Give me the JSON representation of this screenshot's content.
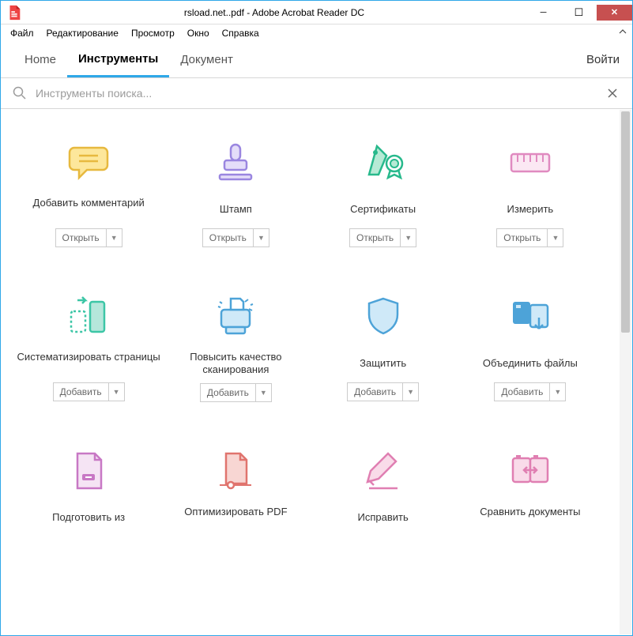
{
  "window": {
    "title": "rsload.net..pdf - Adobe Acrobat Reader DC"
  },
  "menu": {
    "file": "Файл",
    "edit": "Редактирование",
    "view": "Просмотр",
    "window": "Окно",
    "help": "Справка"
  },
  "tabs": {
    "home": "Home",
    "tools": "Инструменты",
    "document": "Документ",
    "signin": "Войти"
  },
  "search": {
    "placeholder": "Инструменты поиска...",
    "value": ""
  },
  "actions": {
    "open": "Открыть",
    "add": "Добавить"
  },
  "tools": [
    {
      "id": "add-comment",
      "label": "Добавить комментарий",
      "action": "open"
    },
    {
      "id": "stamp",
      "label": "Штамп",
      "action": "open"
    },
    {
      "id": "certificates",
      "label": "Сертификаты",
      "action": "open"
    },
    {
      "id": "measure",
      "label": "Измерить",
      "action": "open"
    },
    {
      "id": "organize-pages",
      "label": "Систематизировать страницы",
      "action": "add"
    },
    {
      "id": "enhance-scans",
      "label": "Повысить качество сканирования",
      "action": "add"
    },
    {
      "id": "protect",
      "label": "Защитить",
      "action": "add"
    },
    {
      "id": "combine-files",
      "label": "Объединить файлы",
      "action": "add"
    },
    {
      "id": "prepare-form",
      "label": "Подготовить из",
      "action": "add"
    },
    {
      "id": "optimize-pdf",
      "label": "Оптимизировать PDF",
      "action": "add"
    },
    {
      "id": "redact",
      "label": "Исправить",
      "action": "add"
    },
    {
      "id": "compare",
      "label": "Сравнить документы",
      "action": "add"
    }
  ]
}
